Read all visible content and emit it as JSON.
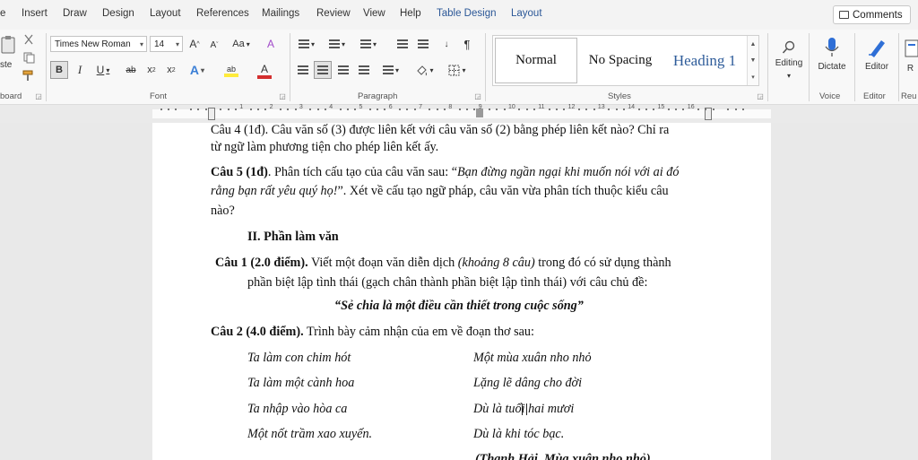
{
  "tabs": {
    "file_partial": "e",
    "insert": "Insert",
    "draw": "Draw",
    "design": "Design",
    "layout": "Layout",
    "references": "References",
    "mailings": "Mailings",
    "review": "Review",
    "view": "View",
    "help": "Help",
    "table_design": "Table Design",
    "table_layout": "Layout",
    "comments": "Comments"
  },
  "clipboard": {
    "paste_partial": "ste",
    "label": "board"
  },
  "font": {
    "name": "Times New Roman",
    "size": "14",
    "grow": "A",
    "shrink": "A",
    "case": "Aa",
    "clear": "A",
    "bold": "B",
    "italic": "I",
    "underline": "U",
    "strike": "ab",
    "subscript": "x",
    "superscript": "x",
    "text_effects": "A",
    "highlight": "ab",
    "font_color": "A",
    "label": "Font"
  },
  "paragraph": {
    "pilcrow": "¶",
    "label": "Paragraph"
  },
  "styles": {
    "normal": "Normal",
    "no_spacing": "No Spacing",
    "heading1": "Heading 1",
    "label": "Styles"
  },
  "editing": {
    "label": "Editing"
  },
  "voice": {
    "dictate": "Dictate",
    "label": "Voice"
  },
  "editor": {
    "button": "Editor",
    "label": "Editor"
  },
  "reuse": {
    "button_partial": "R",
    "label": "Reu"
  },
  "ruler": {
    "numbers": [
      "1",
      "2",
      "3",
      "4",
      "5",
      "6",
      "7",
      "8",
      "9",
      "10",
      "11",
      "12",
      "13",
      "14",
      "15",
      "16"
    ]
  },
  "colors": {
    "accent": "#2b5797",
    "highlight": "#ffeb3b",
    "font_red": "#d32f2f",
    "heading_blue": "#2e5c9a"
  },
  "document": {
    "q4_line1": "Câu 4 (1đ). Câu văn số (3) được liên kết với câu văn số (2) bằng phép liên kết nào? Chỉ ra",
    "q4_line2": "từ ngữ làm phương tiện cho phép liên kết ấy.",
    "q5_label": "Câu 5 (1đ)",
    "q5_text_a": ". Phân tích cấu tạo của câu văn sau: “",
    "q5_quote_a": "Bạn đừng ngần ngại khi muốn nói với ai đó",
    "q5_quote_b": "rằng bạn rất yêu quý họ!",
    "q5_text_b": "”. Xét về cấu tạo ngữ pháp, câu văn vừa phân tích thuộc kiểu câu",
    "q5_line3": "nào?",
    "section2": "II. Phần làm văn",
    "c1_label": "Câu 1 (2.0 điểm).",
    "c1_text_a": " Viết một đoạn văn diễn dịch ",
    "c1_italic": "(khoảng 8 câu)",
    "c1_text_b": " trong đó có sử dụng thành",
    "c1_line2": "phần biệt lập tình thái (gạch chân thành phần biệt lập tình thái) với câu chủ đề:",
    "c1_topic": "“Sẻ chia là một điều cần thiết trong cuộc sống”",
    "c2_label": "Câu 2 (4.0 điểm).",
    "c2_text": " Trình bày cảm nhận của em về đoạn thơ sau:",
    "poem_left": [
      "Ta làm con chim hót",
      "Ta làm một cành hoa",
      "Ta nhập vào hòa ca",
      "Một nốt trầm xao xuyến."
    ],
    "poem_right": [
      "Một mùa xuân nho nhỏ",
      "Lặng lẽ dâng cho đời",
      "Dù là tuổi hai mươi",
      "Dù là khi tóc bạc."
    ],
    "source": "(Thanh Hải, Mùa xuân nho nhỏ)"
  }
}
